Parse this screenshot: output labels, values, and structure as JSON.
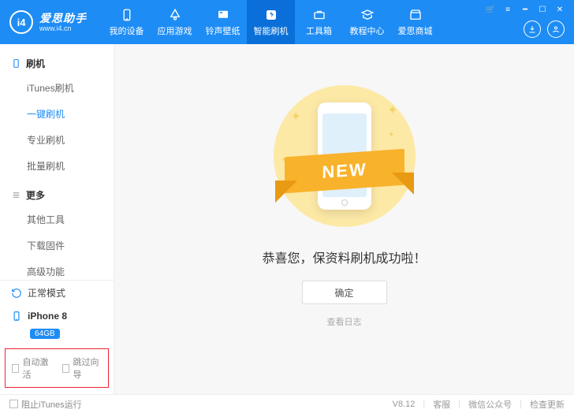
{
  "brand": {
    "cn": "爱思助手",
    "en": "www.i4.cn",
    "logo_letters": "i4"
  },
  "window_controls": [
    "cart-icon",
    "menu-icon",
    "minimize-icon",
    "maximize-icon",
    "close-icon"
  ],
  "topnav": [
    {
      "icon": "device-icon",
      "label": "我的设备"
    },
    {
      "icon": "apps-icon",
      "label": "应用游戏"
    },
    {
      "icon": "wallpaper-icon",
      "label": "铃声壁纸"
    },
    {
      "icon": "flash-icon",
      "label": "智能刷机",
      "active": true
    },
    {
      "icon": "toolbox-icon",
      "label": "工具箱"
    },
    {
      "icon": "tutorial-icon",
      "label": "教程中心"
    },
    {
      "icon": "mall-icon",
      "label": "爱思商城"
    }
  ],
  "userbar": {
    "download": "download-icon",
    "profile": "profile-icon"
  },
  "sidebar": {
    "groups": [
      {
        "icon": "device-outline-icon",
        "title": "刷机",
        "items": [
          "iTunes刷机",
          "一键刷机",
          "专业刷机",
          "批量刷机"
        ],
        "active_index": 1
      },
      {
        "icon": "list-icon",
        "title": "更多",
        "items": [
          "其他工具",
          "下载固件",
          "高级功能"
        ],
        "active_index": -1
      }
    ],
    "mode": {
      "icon": "refresh-icon",
      "label": "正常模式"
    },
    "device": {
      "icon": "phone-icon",
      "name": "iPhone 8",
      "badge": "64GB"
    },
    "options": {
      "auto_activate": "自动激活",
      "skip_guide": "跳过向导"
    }
  },
  "content": {
    "ribbon": "NEW",
    "success_text": "恭喜您，保资料刷机成功啦！",
    "ok_button": "确定",
    "view_log": "查看日志"
  },
  "footer": {
    "block_itunes": "阻止iTunes运行",
    "version": "V8.12",
    "links": [
      "客服",
      "微信公众号",
      "检查更新"
    ]
  }
}
